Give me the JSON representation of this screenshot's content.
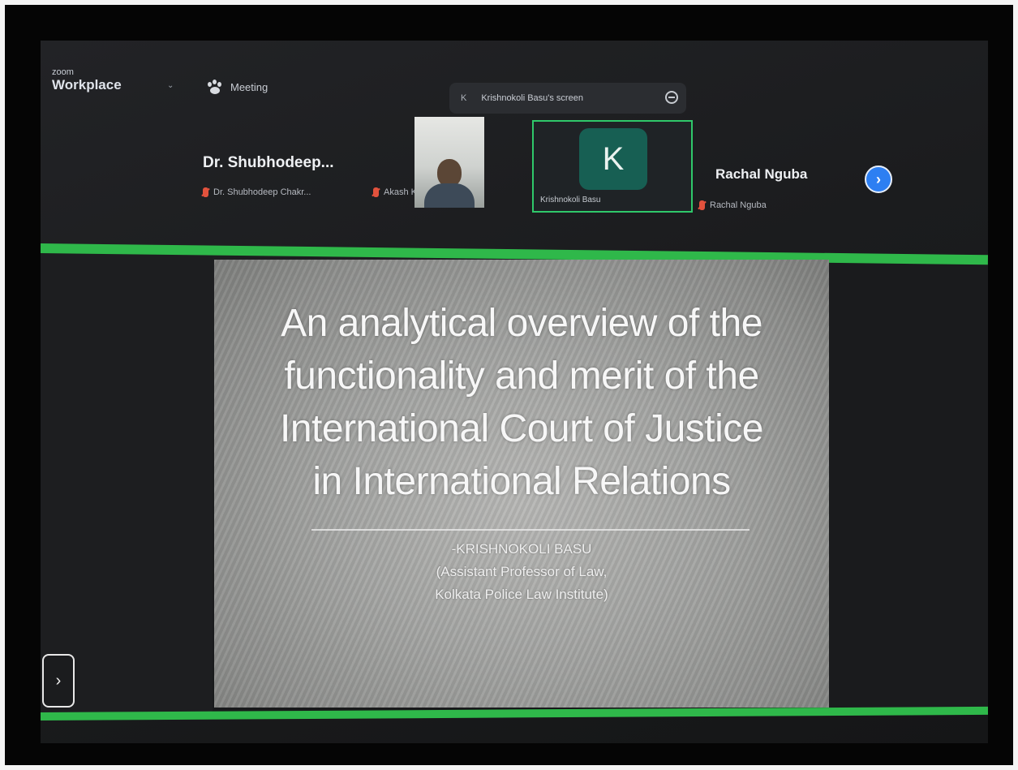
{
  "app": {
    "brand_small": "zoom",
    "brand_name": "Workplace",
    "meeting_label": "Meeting"
  },
  "share_indicator": {
    "initial": "K",
    "text": "Krishnokoli Basu's screen"
  },
  "participants": [
    {
      "display_name": "Dr. Shubhodeep...",
      "sub_label": "Dr. Shubhodeep Chakr..."
    },
    {
      "video_label": "Akash Kumar"
    },
    {
      "avatar_letter": "K",
      "tile_label": "Krishnokoli Basu"
    },
    {
      "display_name": "Rachal Nguba",
      "sub_label": "Rachal Nguba"
    }
  ],
  "slide": {
    "title_lines": [
      "An analytical overview of the",
      "functionality and merit of the",
      "International Court of Justice",
      "in International Relations"
    ],
    "author_lines": [
      "-KRISHNOKOLI BASU",
      "(Assistant Professor of Law,",
      "Kolkata Police Law Institute)"
    ]
  },
  "controls": {
    "next_participants_symbol": "›",
    "expand_symbol": "›"
  },
  "colors": {
    "share_border": "#2fb84a",
    "active_speaker_border": "#2fc86a",
    "avatar_bg": "#175f53",
    "next_button": "#2d7ff2",
    "muted_icon": "#e2523d"
  }
}
